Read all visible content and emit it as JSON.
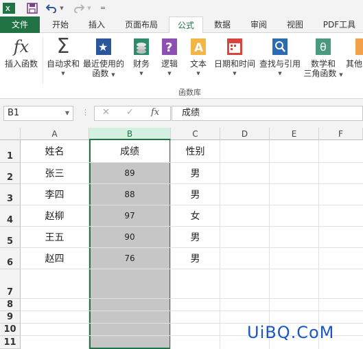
{
  "ribbon_tabs": [
    "文件",
    "开始",
    "插入",
    "页面布局",
    "公式",
    "数据",
    "审阅",
    "视图",
    "PDF工具"
  ],
  "active_tab": "公式",
  "ribbon_buttons": {
    "insert_function": "插入函数",
    "autosum": "自动求和",
    "recent_line1": "最近使用的",
    "recent_line2": "函数",
    "financial": "财务",
    "logical": "逻辑",
    "text": "文本",
    "datetime": "日期和时间",
    "lookup": "查找与引用",
    "math_line1": "数学和",
    "math_line2": "三角函数",
    "more": "其他"
  },
  "group_label": "函数库",
  "formula_bar": {
    "name_box": "B1",
    "content": "成绩",
    "fx": "fx"
  },
  "columns": [
    "A",
    "B",
    "C",
    "D",
    "E",
    "F"
  ],
  "rows": [
    "1",
    "2",
    "3",
    "4",
    "5",
    "6",
    "7",
    "8",
    "9",
    "10",
    "11"
  ],
  "cells": [
    [
      "姓名",
      "成绩",
      "性别"
    ],
    [
      "张三",
      "89",
      "男"
    ],
    [
      "李四",
      "88",
      "男"
    ],
    [
      "赵柳",
      "97",
      "女"
    ],
    [
      "王五",
      "90",
      "男"
    ],
    [
      "赵四",
      "76",
      "男"
    ]
  ],
  "watermark": "UiBQ.CoM",
  "colors": {
    "excel_green": "#217346",
    "selection_fill": "#c6c6c6",
    "watermark_blue": "#1a56c4"
  }
}
